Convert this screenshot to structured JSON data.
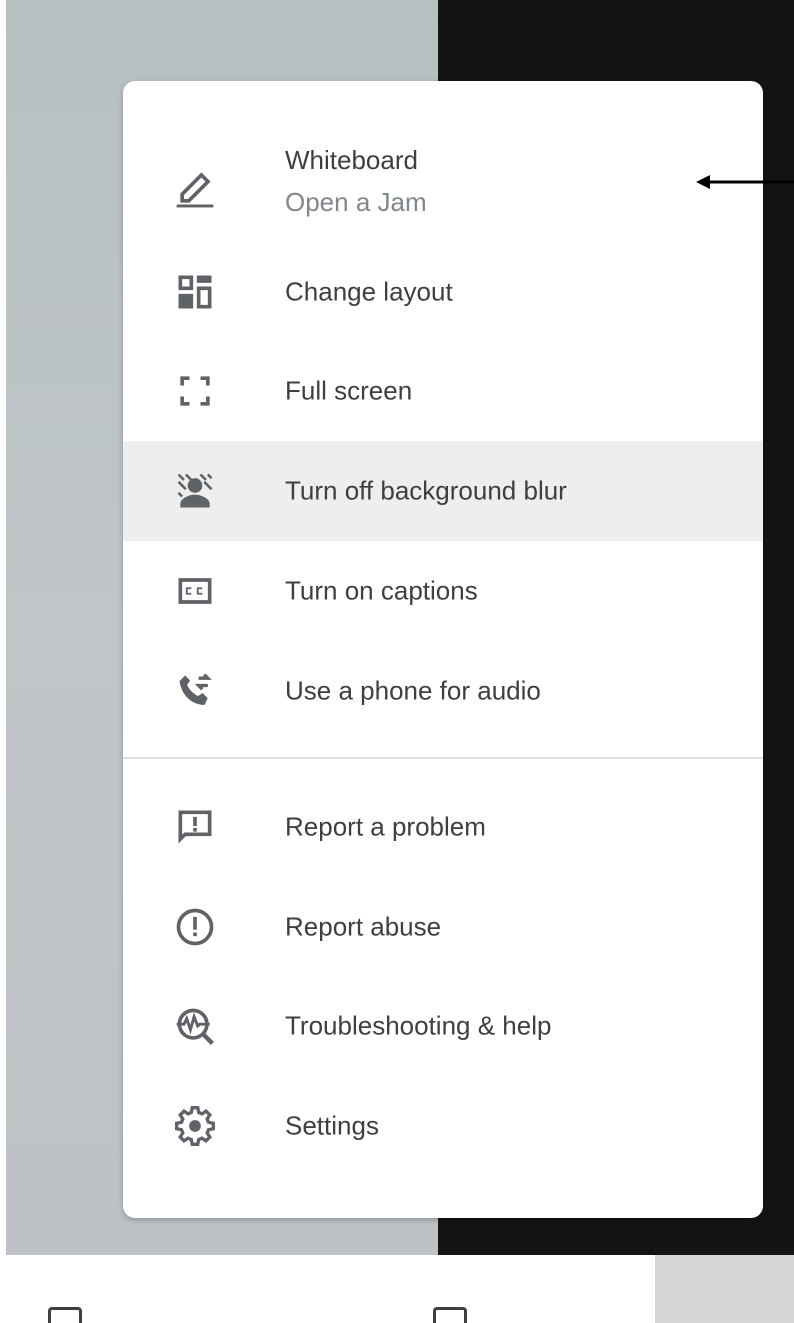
{
  "menu": {
    "items": [
      {
        "label": "Whiteboard",
        "sublabel": "Open a Jam",
        "icon": "pencil-icon"
      },
      {
        "label": "Change layout",
        "icon": "layout-icon"
      },
      {
        "label": "Full screen",
        "icon": "fullscreen-icon"
      },
      {
        "label": "Turn off background blur",
        "icon": "background-blur-icon",
        "highlighted": true
      },
      {
        "label": "Turn on captions",
        "icon": "captions-icon"
      },
      {
        "label": "Use a phone for audio",
        "icon": "phone-forward-icon"
      },
      {
        "label": "Report a problem",
        "icon": "feedback-icon"
      },
      {
        "label": "Report abuse",
        "icon": "report-icon"
      },
      {
        "label": "Troubleshooting & help",
        "icon": "troubleshoot-icon"
      },
      {
        "label": "Settings",
        "icon": "gear-icon"
      }
    ]
  },
  "colors": {
    "icon": "#5f6368",
    "text": "#3c4043",
    "secondary_text": "#80868b",
    "highlight": "#eeeeee",
    "left_background": "#bec2c6",
    "right_background": "#141414"
  },
  "annotation": {
    "icon": "arrow-left-icon"
  }
}
